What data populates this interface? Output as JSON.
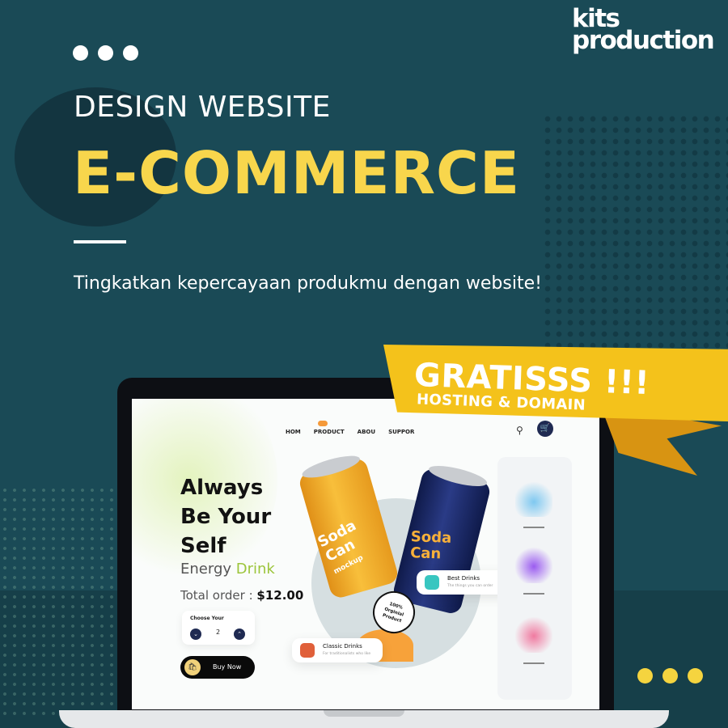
{
  "brand": {
    "logo_line1": "kits",
    "logo_line2": "production"
  },
  "heading": {
    "line1": "DESIGN WEBSITE",
    "line2": "E-COMMERCE"
  },
  "subtitle": "Tingkatkan kepercayaan produkmu dengan website!",
  "ribbon": {
    "main": "GRATISSS !!!",
    "sub": "HOSTING & DOMAIN"
  },
  "colors": {
    "background": "#1a4a56",
    "accent_yellow": "#f8d64c",
    "ribbon": "#f4c21b",
    "navy": "#1f2a52"
  },
  "mockup": {
    "nav": [
      {
        "label": "HOM",
        "icon": ""
      },
      {
        "label": "PRODUCT",
        "icon": "badge-icon"
      },
      {
        "label": "ABOU",
        "icon": ""
      },
      {
        "label": "SUPPOR",
        "icon": ""
      }
    ],
    "icons": {
      "search": "search-icon",
      "cart": "cart-icon"
    },
    "hero": {
      "title_line1": "Always",
      "title_line2": "Be Your",
      "title_line3": "Self",
      "subtitle_word1": "Energy",
      "subtitle_word2": "Drink",
      "total_label": "Total order :",
      "total_value": "$12.00"
    },
    "quantity": {
      "label": "Choose Your",
      "value": "2"
    },
    "buy_button": {
      "label": "Buy Now"
    },
    "cans": {
      "yellow_text": "Soda Can",
      "yellow_subtext": "mockup",
      "blue_text": "Soda Can"
    },
    "seal_text": {
      "line1": "100%",
      "line2": "Orginial",
      "line3": "Product"
    },
    "cards": [
      {
        "title": "Best Drinks",
        "subtitle": "The things you can order"
      },
      {
        "title": "Classic Drinks",
        "subtitle": "For traditionalists who like"
      }
    ]
  }
}
